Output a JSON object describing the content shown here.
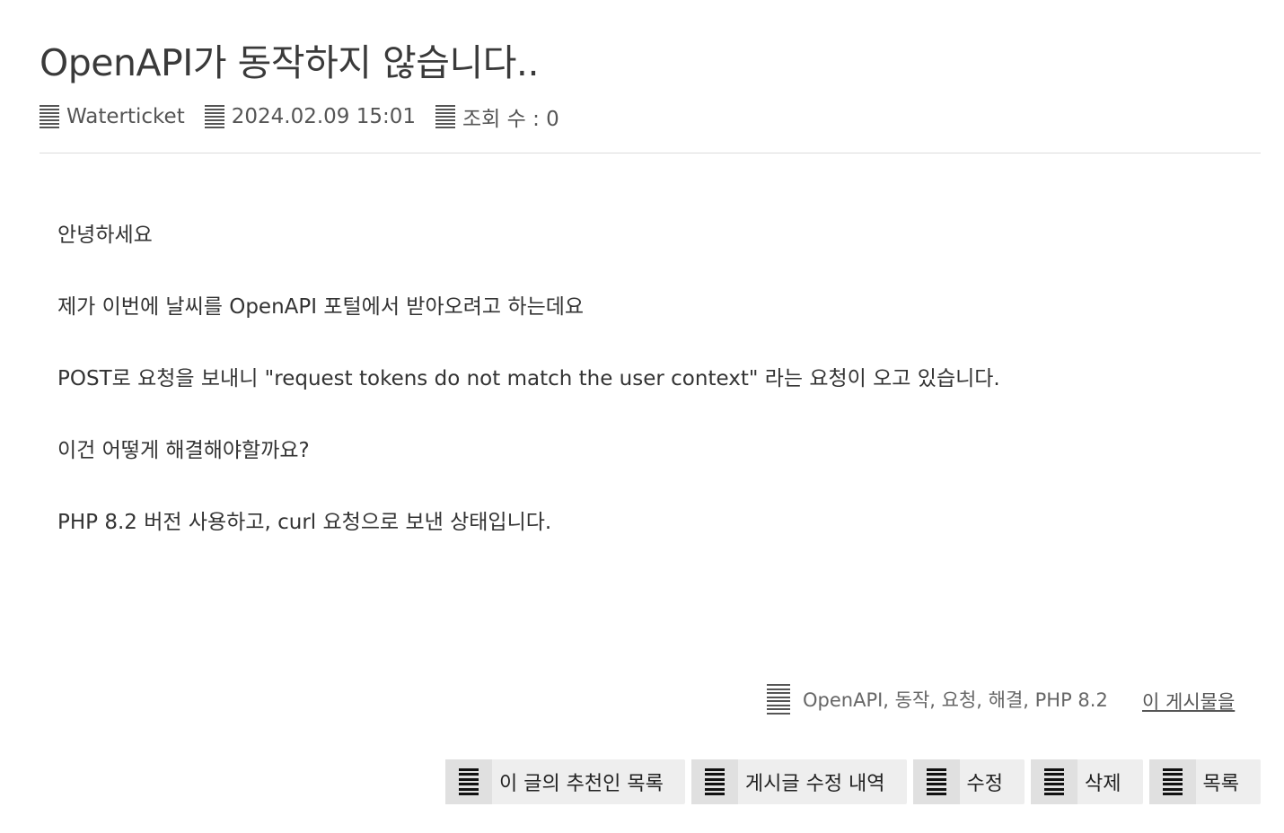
{
  "post": {
    "title": "OpenAPI가 동작하지 않습니다..",
    "author": "Waterticket",
    "date": "2024.02.09 15:01",
    "views": "조회 수 : 0"
  },
  "content": {
    "paragraphs": [
      "안녕하세요",
      "제가 이번에 날씨를 OpenAPI 포털에서 받아오려고 하는데요",
      "POST로 요청을 보내니 \"request tokens do not match the user context\" 라는 요청이 오고 있습니다.",
      "이건 어떻게 해결해야할까요?",
      "PHP 8.2 버전 사용하고, curl 요청으로 보낸 상태입니다."
    ]
  },
  "tags": {
    "text": "OpenAPI, 동작, 요청, 해결, PHP 8.2",
    "post_link": "이 게시물을"
  },
  "actions": {
    "recommenders": "이 글의 추천인 목록",
    "edit_history": "게시글 수정 내역",
    "edit": "수정",
    "delete": "삭제",
    "list": "목록"
  },
  "icons": {
    "author": "lines-icon",
    "date": "lines-icon",
    "views": "lines-icon",
    "tags": "lines-icon",
    "buttons": "lines-icon"
  }
}
